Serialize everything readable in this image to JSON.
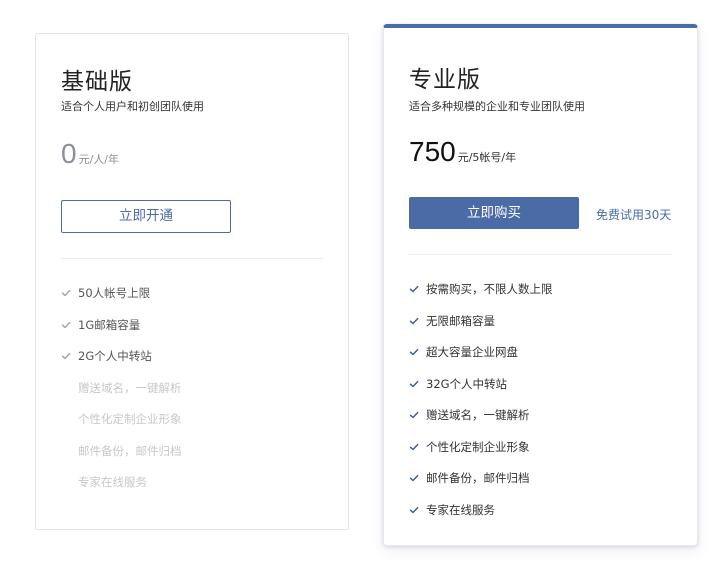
{
  "colors": {
    "accent": "#4b6ba7",
    "price_zero": "#8a8f99",
    "disabled_text": "#c8c8c8"
  },
  "basic": {
    "title": "基础版",
    "subtitle": "适合个人用户和初创团队使用",
    "price": "0",
    "price_unit": "元/人/年",
    "button_label": "立即开通",
    "features": [
      {
        "label": "50人帐号上限",
        "enabled": true
      },
      {
        "label": "1G邮箱容量",
        "enabled": true
      },
      {
        "label": "2G个人中转站",
        "enabled": true
      },
      {
        "label": "赠送域名，一键解析",
        "enabled": false
      },
      {
        "label": "个性化定制企业形象",
        "enabled": false
      },
      {
        "label": "邮件备份，邮件归档",
        "enabled": false
      },
      {
        "label": "专家在线服务",
        "enabled": false
      }
    ]
  },
  "pro": {
    "title": "专业版",
    "subtitle": "适合多种规模的企业和专业团队使用",
    "price": "750",
    "price_unit": "元/5帐号/年",
    "button_label": "立即购买",
    "trial_link": "免费试用30天",
    "features": [
      {
        "label": "按需购买，不限人数上限",
        "enabled": true
      },
      {
        "label": "无限邮箱容量",
        "enabled": true
      },
      {
        "label": "超大容量企业网盘",
        "enabled": true
      },
      {
        "label": "32G个人中转站",
        "enabled": true
      },
      {
        "label": "赠送域名，一键解析",
        "enabled": true
      },
      {
        "label": "个性化定制企业形象",
        "enabled": true
      },
      {
        "label": "邮件备份，邮件归档",
        "enabled": true
      },
      {
        "label": "专家在线服务",
        "enabled": true
      }
    ]
  }
}
